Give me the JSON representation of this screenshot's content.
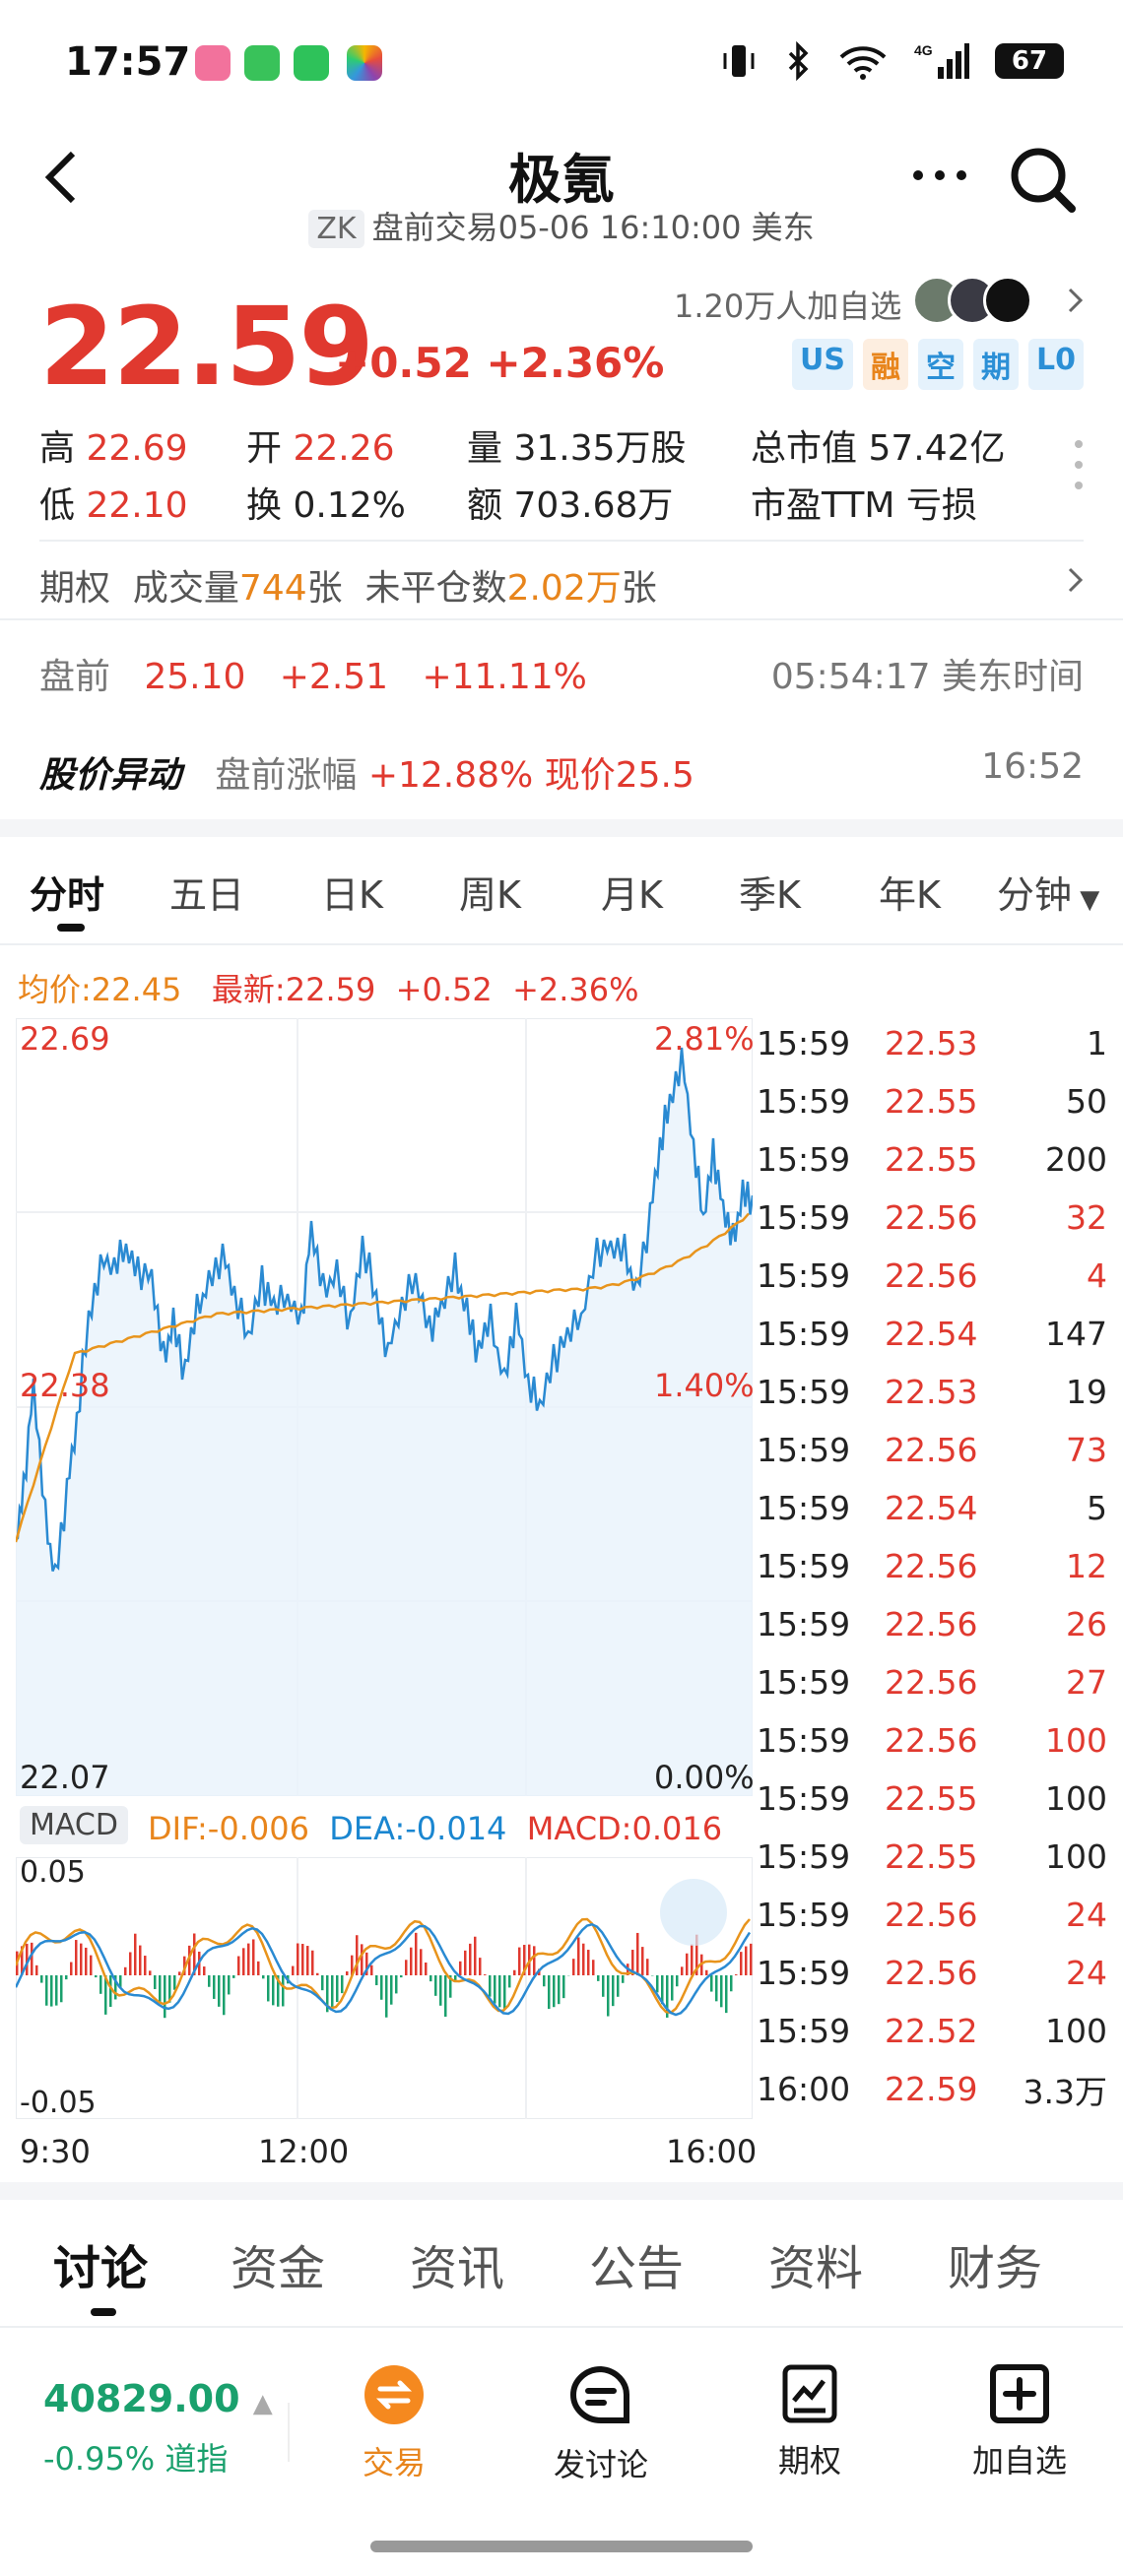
{
  "status": {
    "time": "17:57",
    "battery": "67"
  },
  "header": {
    "title": "极氪",
    "ticker": "ZK",
    "subtitle": "盘前交易05-06 16:10:00 美东"
  },
  "quote": {
    "price": "22.59",
    "change": "+0.52",
    "change_pct": "+2.36%",
    "watchers": "1.20万人加自选",
    "badges": [
      "US",
      "融",
      "空",
      "期",
      "L0"
    ]
  },
  "stats": {
    "high_label": "高",
    "high": "22.69",
    "open_label": "开",
    "open": "22.26",
    "vol_label": "量",
    "vol": "31.35万股",
    "mcap_label": "总市值",
    "mcap": "57.42亿",
    "low_label": "低",
    "low": "22.10",
    "turn_label": "换",
    "turn": "0.12%",
    "amt_label": "额",
    "amt": "703.68万",
    "pe_label": "市盈TTM",
    "pe": "亏损"
  },
  "options": {
    "label": "期权",
    "vol_label": "成交量",
    "vol": "744",
    "vol_unit": "张",
    "oi_label": "未平仓数",
    "oi": "2.02万",
    "oi_unit": "张"
  },
  "premarket": {
    "label": "盘前",
    "price": "25.10",
    "change": "+2.51",
    "pct": "+11.11%",
    "time": "05:54:17 美东时间"
  },
  "alert": {
    "label": "股价异动",
    "text1": "盘前涨幅 ",
    "pct": "+12.88%",
    "text2": " 现价25.5",
    "time": "16:52"
  },
  "ktabs": [
    "分时",
    "五日",
    "日K",
    "周K",
    "月K",
    "季K",
    "年K",
    "分钟"
  ],
  "legend": {
    "avg_label": "均价:",
    "avg": "22.45",
    "last_label": "最新:",
    "last": "22.59",
    "chg": "+0.52",
    "pct": "+2.36%"
  },
  "axis": {
    "top": "22.69",
    "mid": "22.38",
    "bot": "22.07",
    "pct_top": "2.81%",
    "pct_mid": "1.40%",
    "pct_bot": "0.00%",
    "t1": "9:30",
    "t2": "12:00",
    "t3": "16:00"
  },
  "macd": {
    "label": "MACD",
    "dif": "DIF:-0.006",
    "dea": "DEA:-0.014",
    "macd": "MACD:0.016",
    "top": "0.05",
    "bot": "-0.05"
  },
  "trades": [
    {
      "t": "15:59",
      "p": "22.53",
      "v": "1",
      "vc": "#222"
    },
    {
      "t": "15:59",
      "p": "22.55",
      "v": "50",
      "vc": "#222"
    },
    {
      "t": "15:59",
      "p": "22.55",
      "v": "200",
      "vc": "#222"
    },
    {
      "t": "15:59",
      "p": "22.56",
      "v": "32",
      "vc": "#e0392f"
    },
    {
      "t": "15:59",
      "p": "22.56",
      "v": "4",
      "vc": "#e0392f"
    },
    {
      "t": "15:59",
      "p": "22.54",
      "v": "147",
      "vc": "#222"
    },
    {
      "t": "15:59",
      "p": "22.53",
      "v": "19",
      "vc": "#222"
    },
    {
      "t": "15:59",
      "p": "22.56",
      "v": "73",
      "vc": "#e0392f"
    },
    {
      "t": "15:59",
      "p": "22.54",
      "v": "5",
      "vc": "#222"
    },
    {
      "t": "15:59",
      "p": "22.56",
      "v": "12",
      "vc": "#e0392f"
    },
    {
      "t": "15:59",
      "p": "22.56",
      "v": "26",
      "vc": "#e0392f"
    },
    {
      "t": "15:59",
      "p": "22.56",
      "v": "27",
      "vc": "#e0392f"
    },
    {
      "t": "15:59",
      "p": "22.56",
      "v": "100",
      "vc": "#e0392f"
    },
    {
      "t": "15:59",
      "p": "22.55",
      "v": "100",
      "vc": "#222"
    },
    {
      "t": "15:59",
      "p": "22.55",
      "v": "100",
      "vc": "#222"
    },
    {
      "t": "15:59",
      "p": "22.56",
      "v": "24",
      "vc": "#e0392f"
    },
    {
      "t": "15:59",
      "p": "22.56",
      "v": "24",
      "vc": "#e0392f"
    },
    {
      "t": "15:59",
      "p": "22.52",
      "v": "100",
      "vc": "#222"
    },
    {
      "t": "16:00",
      "p": "22.59",
      "v": "3.3万",
      "vc": "#222"
    }
  ],
  "bottom_tabs": [
    "讨论",
    "资金",
    "资讯",
    "公告",
    "资料",
    "财务"
  ],
  "index": {
    "value": "40829.00",
    "pct": "-0.95%",
    "name": "道指"
  },
  "nav": {
    "trade": "交易",
    "post": "发讨论",
    "options": "期权",
    "watch": "加自选"
  }
}
